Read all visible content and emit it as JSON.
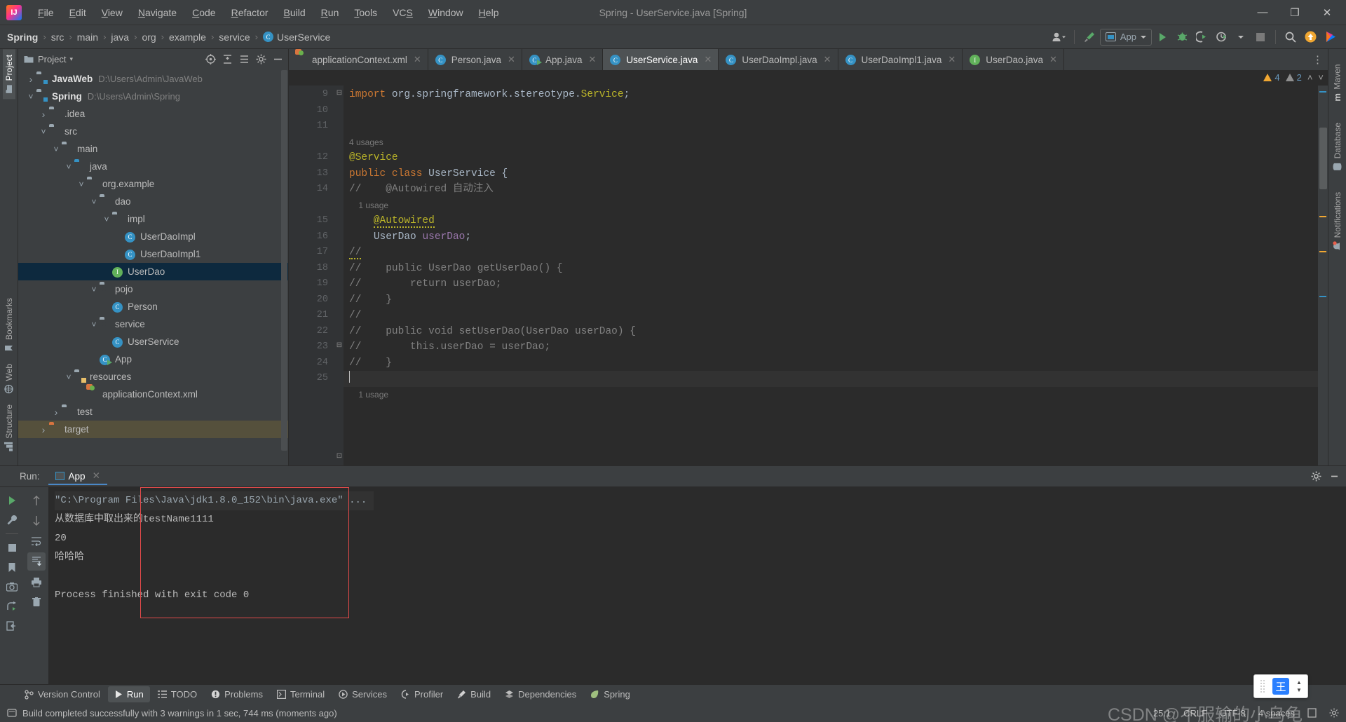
{
  "window": {
    "title": "Spring - UserService.java [Spring]",
    "logo_text": "IJ",
    "minimize": "—",
    "maximize": "❐",
    "close": "✕"
  },
  "menu": [
    "File",
    "Edit",
    "View",
    "Navigate",
    "Code",
    "Refactor",
    "Build",
    "Run",
    "Tools",
    "VCS",
    "Window",
    "Help"
  ],
  "breadcrumb": {
    "items": [
      "Spring",
      "src",
      "main",
      "java",
      "org",
      "example",
      "service",
      "UserService"
    ],
    "separator": "›",
    "class_icon": "C"
  },
  "toolbar": {
    "account_icon": "account-icon",
    "updates_icon": "hammer-icon",
    "run_config": "App",
    "run_icon": "run-icon",
    "debug_icon": "debug-icon",
    "run_coverage_icon": "coverage-icon",
    "profile_icon": "profiler-icon",
    "stop_icon": "stop-icon",
    "search_icon": "search-icon",
    "update_badge_icon": "update-badge-icon",
    "ide_icon": "ide-icon"
  },
  "left_strip": [
    {
      "label": "Project",
      "active": true
    },
    {
      "label": "Bookmarks",
      "active": false
    },
    {
      "label": "Web",
      "active": false
    },
    {
      "label": "Structure",
      "active": false
    }
  ],
  "right_strip": [
    {
      "label": "Maven",
      "icon": "m"
    },
    {
      "label": "Database",
      "icon": "database-icon"
    },
    {
      "label": "Notifications",
      "icon": "bell-icon"
    }
  ],
  "project_panel": {
    "title": "Project",
    "icons": [
      "select-opened-file-icon",
      "expand-all-icon",
      "collapse-all-icon",
      "settings-icon",
      "hide-icon"
    ],
    "tree": [
      {
        "indent": 0,
        "arrow": "collapsed",
        "icon": "module-folder",
        "label": "JavaWeb",
        "bold": true,
        "path": "D:\\Users\\Admin\\JavaWeb"
      },
      {
        "indent": 0,
        "arrow": "expanded",
        "icon": "module-folder",
        "label": "Spring",
        "bold": true,
        "path": "D:\\Users\\Admin\\Spring"
      },
      {
        "indent": 1,
        "arrow": "collapsed",
        "icon": "folder",
        "label": ".idea",
        "bold": false,
        "path": ""
      },
      {
        "indent": 1,
        "arrow": "expanded",
        "icon": "folder",
        "label": "src",
        "bold": false,
        "path": ""
      },
      {
        "indent": 2,
        "arrow": "expanded",
        "icon": "folder",
        "label": "main",
        "bold": false,
        "path": ""
      },
      {
        "indent": 3,
        "arrow": "expanded",
        "icon": "source-folder",
        "label": "java",
        "bold": false,
        "path": ""
      },
      {
        "indent": 4,
        "arrow": "expanded",
        "icon": "package",
        "label": "org.example",
        "bold": false,
        "path": ""
      },
      {
        "indent": 5,
        "arrow": "expanded",
        "icon": "package",
        "label": "dao",
        "bold": false,
        "path": ""
      },
      {
        "indent": 6,
        "arrow": "expanded",
        "icon": "package",
        "label": "impl",
        "bold": false,
        "path": ""
      },
      {
        "indent": 7,
        "arrow": "none",
        "icon": "class",
        "label": "UserDaoImpl",
        "bold": false,
        "path": ""
      },
      {
        "indent": 7,
        "arrow": "none",
        "icon": "class",
        "label": "UserDaoImpl1",
        "bold": false,
        "path": ""
      },
      {
        "indent": 6,
        "arrow": "none",
        "icon": "interface",
        "label": "UserDao",
        "bold": false,
        "path": "",
        "selected": true
      },
      {
        "indent": 5,
        "arrow": "expanded",
        "icon": "package",
        "label": "pojo",
        "bold": false,
        "path": ""
      },
      {
        "indent": 6,
        "arrow": "none",
        "icon": "class",
        "label": "Person",
        "bold": false,
        "path": ""
      },
      {
        "indent": 5,
        "arrow": "expanded",
        "icon": "package",
        "label": "service",
        "bold": false,
        "path": ""
      },
      {
        "indent": 6,
        "arrow": "none",
        "icon": "class",
        "label": "UserService",
        "bold": false,
        "path": ""
      },
      {
        "indent": 5,
        "arrow": "none",
        "icon": "runnable-class",
        "label": "App",
        "bold": false,
        "path": ""
      },
      {
        "indent": 3,
        "arrow": "expanded",
        "icon": "resource-folder",
        "label": "resources",
        "bold": false,
        "path": ""
      },
      {
        "indent": 4,
        "arrow": "none",
        "icon": "xml",
        "label": "applicationContext.xml",
        "bold": false,
        "path": ""
      },
      {
        "indent": 2,
        "arrow": "collapsed",
        "icon": "folder",
        "label": "test",
        "bold": false,
        "path": ""
      },
      {
        "indent": 1,
        "arrow": "collapsed",
        "icon": "target-folder",
        "label": "target",
        "bold": false,
        "path": "",
        "target": true
      }
    ]
  },
  "editor": {
    "tabs": [
      {
        "label": "applicationContext.xml",
        "icon": "xml-file-icon",
        "active": false
      },
      {
        "label": "Person.java",
        "icon": "class-icon",
        "active": false
      },
      {
        "label": "App.java",
        "icon": "runnable-class-icon",
        "active": false
      },
      {
        "label": "UserService.java",
        "icon": "class-icon",
        "active": true
      },
      {
        "label": "UserDaoImpl.java",
        "icon": "class-icon",
        "active": false
      },
      {
        "label": "UserDaoImpl1.java",
        "icon": "class-icon",
        "active": false
      },
      {
        "label": "UserDao.java",
        "icon": "interface-icon",
        "active": false
      }
    ],
    "tab_close": "✕",
    "tab_overflow_icon": "more-tabs-icon",
    "inspections": {
      "warnings": "4",
      "weak_warnings": "2",
      "prev_icon": "˄",
      "next_icon": "˅"
    },
    "line_numbers": [
      "9",
      "10",
      "11",
      "12",
      "13",
      "14",
      "15",
      "16",
      "17",
      "18",
      "19",
      "20",
      "21",
      "22",
      "23",
      "24",
      "25"
    ],
    "lines": [
      {
        "num": "9",
        "html": "<span class=\"k\">import</span> org.springframework.stereotype.<span class=\"ann\">Service</span>;"
      },
      {
        "num": "10",
        "html": ""
      },
      {
        "num": "11",
        "html": ""
      },
      {
        "num": "",
        "usage": "4 usages"
      },
      {
        "num": "12",
        "html": "<span class=\"ann\">@Service</span>"
      },
      {
        "num": "13",
        "html": "<span class=\"k\">public class</span> <span class=\"typ\">UserService</span> {"
      },
      {
        "num": "14",
        "html": "<span class=\"cm\">//    @Autowired 自动注入</span>"
      },
      {
        "num": "",
        "usage": "    1 usage"
      },
      {
        "num": "15",
        "html": "    <span class=\"ann wavy\">@Autowired</span>"
      },
      {
        "num": "16",
        "html": "    <span class=\"typ\">UserDao</span> <span class=\"fld\">userDao</span>;"
      },
      {
        "num": "17",
        "html": "<span class=\"cm wavy\">//</span>"
      },
      {
        "num": "18",
        "html": "<span class=\"cm\">//    public UserDao getUserDao() {</span>"
      },
      {
        "num": "19",
        "html": "<span class=\"cm\">//        return userDao;</span>"
      },
      {
        "num": "20",
        "html": "<span class=\"cm\">//    }</span>"
      },
      {
        "num": "21",
        "html": "<span class=\"cm\">//</span>"
      },
      {
        "num": "22",
        "html": "<span class=\"cm\">//    public void setUserDao(UserDao userDao) {</span>"
      },
      {
        "num": "23",
        "html": "<span class=\"cm\">//        this.userDao = userDao;</span>"
      },
      {
        "num": "24",
        "html": "<span class=\"cm\">//    }</span>"
      },
      {
        "num": "25",
        "html": "<span class=\"caret\"></span>",
        "current": true
      },
      {
        "num": "",
        "usage": "    1 usage"
      }
    ]
  },
  "run_panel": {
    "label": "Run:",
    "tab": "App",
    "tab_close": "✕",
    "settings_icon": "gear-icon",
    "hide_icon": "minimize-icon",
    "side_buttons": [
      "rerun-icon",
      "wrench-icon",
      "stop-icon",
      "bookmark-icon",
      "camera-icon",
      "print-icon",
      "export-icon"
    ],
    "side_buttons2": [
      "up-icon",
      "down-icon",
      "soft-wrap-icon",
      "scroll-to-end-icon",
      "print-icon",
      "trash-icon"
    ],
    "console_lines": [
      {
        "text": "\"C:\\Program Files\\Java\\jdk1.8.0_152\\bin\\java.exe\" ...",
        "cmd": true
      },
      {
        "text": "从数据库中取出来的testName1111",
        "cmd": false
      },
      {
        "text": "20",
        "cmd": false
      },
      {
        "text": "哈哈哈",
        "cmd": false
      },
      {
        "text": "",
        "cmd": false
      },
      {
        "text": "Process finished with exit code 0",
        "cmd": false
      }
    ]
  },
  "bottom_tabs": [
    {
      "label": "Version Control",
      "icon": "branch-icon",
      "active": false
    },
    {
      "label": "Run",
      "icon": "run-icon",
      "active": true
    },
    {
      "label": "TODO",
      "icon": "todo-icon",
      "active": false
    },
    {
      "label": "Problems",
      "icon": "problems-icon",
      "active": false
    },
    {
      "label": "Terminal",
      "icon": "terminal-icon",
      "active": false
    },
    {
      "label": "Services",
      "icon": "services-icon",
      "active": false
    },
    {
      "label": "Profiler",
      "icon": "profiler-icon",
      "active": false
    },
    {
      "label": "Build",
      "icon": "build-icon",
      "active": false
    },
    {
      "label": "Dependencies",
      "icon": "dependencies-icon",
      "active": false
    },
    {
      "label": "Spring",
      "icon": "spring-icon",
      "active": false
    }
  ],
  "status_bar": {
    "icon": "build-status-icon",
    "message": "Build completed successfully with 3 warnings in 1 sec, 744 ms (moments ago)",
    "caret_position": "25:1",
    "line_separator": "CRLF",
    "encoding": "UTF-8",
    "indent": "4 spaces",
    "lock_icon": "read-only-icon",
    "settings_icon": "gear-icon"
  },
  "ime_widget": {
    "glyph": "王",
    "up": "▲",
    "down": "▼"
  },
  "watermark": "CSDN @不服输的小乌龟",
  "colors": {
    "accent": "#3592c4",
    "green": "#59a869",
    "warning": "#f0a732",
    "selection": "#0d293e",
    "target": "#55503c",
    "editor_bg": "#2b2b2b",
    "panel_bg": "#3c3f41"
  }
}
